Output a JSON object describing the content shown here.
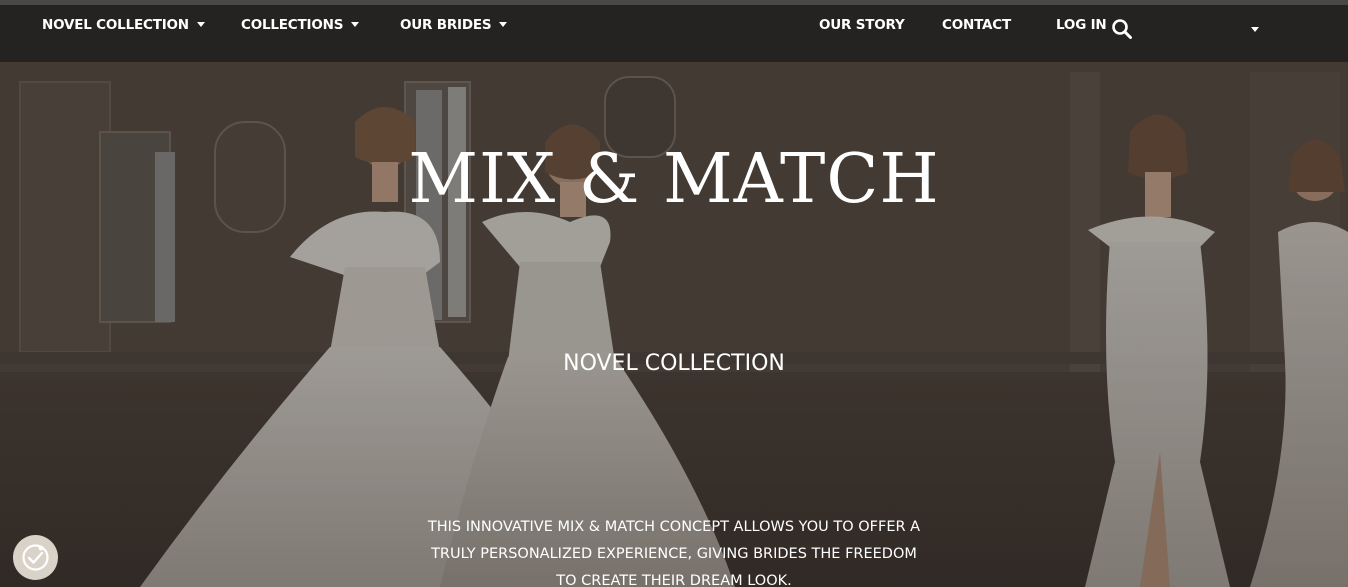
{
  "nav": {
    "left_items": [
      {
        "label": "NOVEL COLLECTION",
        "has_dropdown": true
      },
      {
        "label": "COLLECTIONS",
        "has_dropdown": true
      },
      {
        "label": "OUR BRIDES",
        "has_dropdown": true
      }
    ],
    "right_items": [
      {
        "label": "OUR STORY"
      },
      {
        "label": "CONTACT"
      },
      {
        "label": "LOG IN"
      }
    ],
    "search_icon": "search-icon",
    "language_dropdown_icon": "chevron-down-icon"
  },
  "hero": {
    "title": "MIX & MATCH",
    "subtitle": "NOVEL COLLECTION",
    "description": "THIS INNOVATIVE MIX & MATCH CONCEPT ALLOWS YOU TO OFFER A TRULY PERSONALIZED EXPERIENCE, GIVING BRIDES THE FREEDOM TO CREATE THEIR DREAM LOOK.",
    "background_image": "four brides in white wedding gowns in an ornate hall"
  },
  "cookie_settings": {
    "icon": "cookie-consent-icon"
  },
  "colors": {
    "navbar": "#242322",
    "text": "#ffffff",
    "cookie_button": "#d9d2c8"
  }
}
